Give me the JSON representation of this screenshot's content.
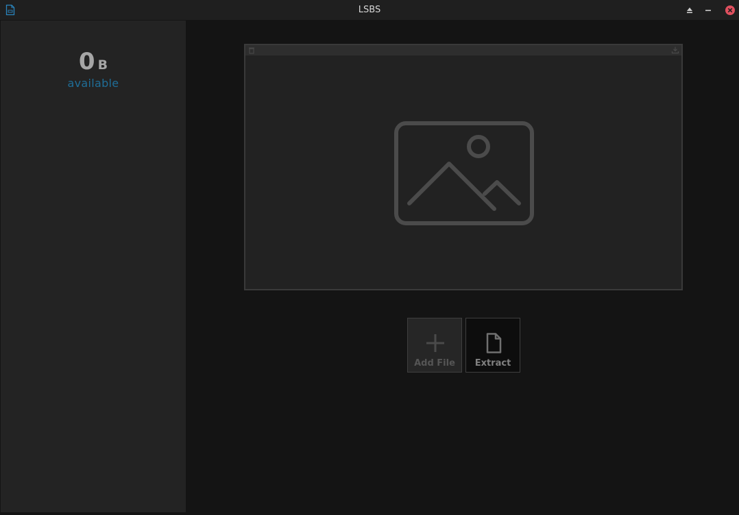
{
  "window": {
    "title": "LSBS",
    "icons": {
      "app": "document-app-icon",
      "keep_above": "eject-icon",
      "minimize": "minimize-icon",
      "close": "close-icon"
    },
    "close_color": "#e0505f"
  },
  "sidebar": {
    "size_value": "0",
    "size_unit": "B",
    "available_label": "available",
    "accent_color": "#1f6e98"
  },
  "image_panel": {
    "icons": {
      "delete": "trash-icon",
      "save": "download-icon",
      "placeholder": "image-placeholder-icon"
    }
  },
  "actions": {
    "add_file_label": "Add File",
    "add_file_icon": "plus-icon",
    "extract_label": "Extract",
    "extract_icon": "file-icon"
  }
}
